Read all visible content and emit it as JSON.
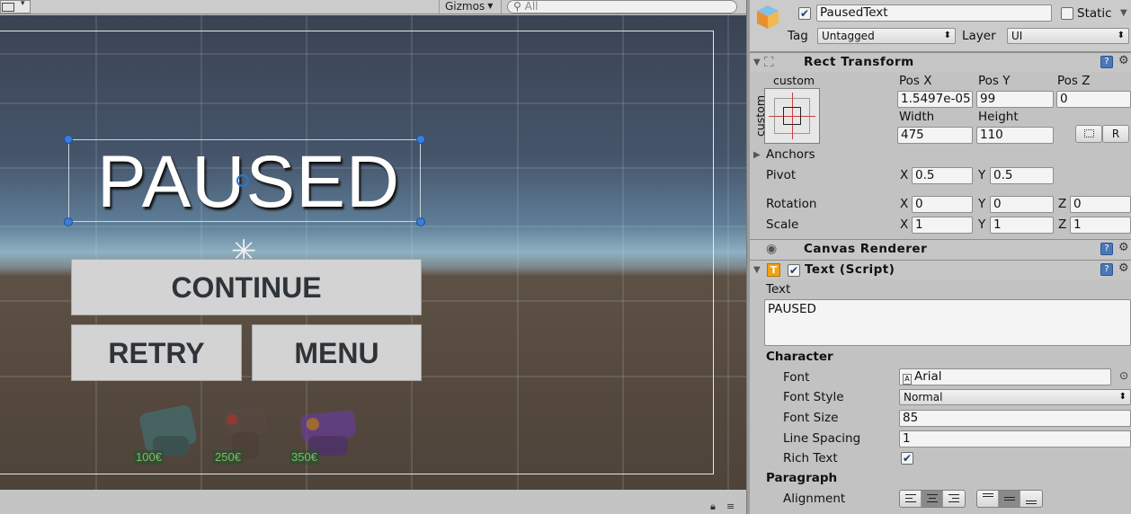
{
  "scene": {
    "toolbar": {
      "gizmos_label": "Gizmos",
      "search_placeholder": "All"
    },
    "paused_text": "PAUSED",
    "buttons": {
      "continue": "CONTINUE",
      "retry": "RETRY",
      "menu": "MENU"
    },
    "shop": {
      "prices": [
        "100€",
        "250€",
        "350€"
      ]
    }
  },
  "inspector": {
    "object": {
      "name": "PausedText",
      "active": true,
      "static_label": "Static",
      "tag_label": "Tag",
      "tag_value": "Untagged",
      "layer_label": "Layer",
      "layer_value": "UI"
    },
    "rect_transform": {
      "title": "Rect Transform",
      "preset_top_label": "custom",
      "preset_side_label": "custom",
      "pos_x_label": "Pos X",
      "pos_y_label": "Pos Y",
      "pos_z_label": "Pos Z",
      "pos_x": "1.5497e-05",
      "pos_y": "99",
      "pos_z": "0",
      "width_label": "Width",
      "height_label": "Height",
      "width": "475",
      "height": "110",
      "raw_edit_label": "R",
      "anchors_label": "Anchors",
      "pivot_label": "Pivot",
      "pivot_x": "0.5",
      "pivot_y": "0.5",
      "rotation_label": "Rotation",
      "rotation_x": "0",
      "rotation_y": "0",
      "rotation_z": "0",
      "scale_label": "Scale",
      "scale_x": "1",
      "scale_y": "1",
      "scale_z": "1",
      "axis_x": "X",
      "axis_y": "Y",
      "axis_z": "Z"
    },
    "canvas_renderer": {
      "title": "Canvas Renderer"
    },
    "text_script": {
      "title": "Text (Script)",
      "enabled": true,
      "text_label": "Text",
      "text_value": "PAUSED",
      "character_label": "Character",
      "font_label": "Font",
      "font_value": "Arial",
      "font_style_label": "Font Style",
      "font_style_value": "Normal",
      "font_size_label": "Font Size",
      "font_size_value": "85",
      "line_spacing_label": "Line Spacing",
      "line_spacing_value": "1",
      "rich_text_label": "Rich Text",
      "rich_text": true,
      "paragraph_label": "Paragraph",
      "alignment_label": "Alignment"
    }
  },
  "colors": {
    "ui_button_bg": "#d3d3d3",
    "gizmo_handle": "#3b7dd8",
    "price_green": "#6fc06f",
    "inspector_bg": "#c2c2c2"
  }
}
